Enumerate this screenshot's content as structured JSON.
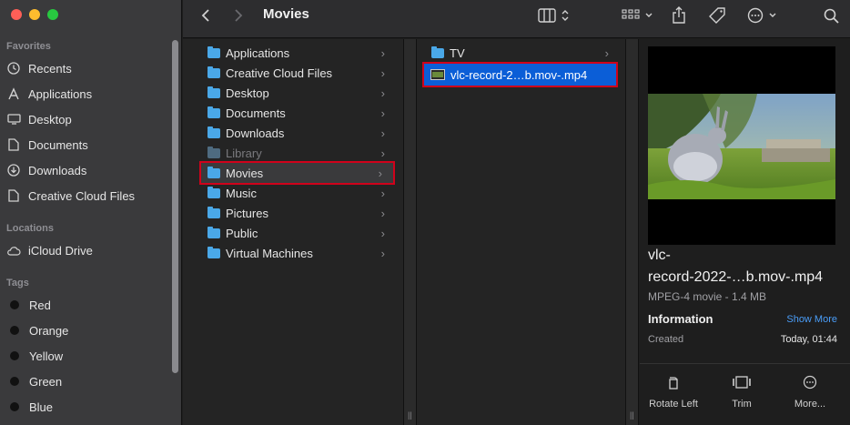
{
  "window": {
    "title": "Movies",
    "traffic_colors": [
      "#fe5f57",
      "#febc2e",
      "#28c840"
    ]
  },
  "sidebar": {
    "favorites_label": "Favorites",
    "favorites": [
      {
        "label": "Recents",
        "icon": "clock-icon"
      },
      {
        "label": "Applications",
        "icon": "applications-icon"
      },
      {
        "label": "Desktop",
        "icon": "desktop-icon"
      },
      {
        "label": "Documents",
        "icon": "document-icon"
      },
      {
        "label": "Downloads",
        "icon": "download-icon"
      },
      {
        "label": "Creative Cloud Files",
        "icon": "document-icon"
      }
    ],
    "locations_label": "Locations",
    "locations": [
      {
        "label": "iCloud Drive",
        "icon": "cloud-icon"
      }
    ],
    "tags_label": "Tags",
    "tags": [
      {
        "label": "Red"
      },
      {
        "label": "Orange"
      },
      {
        "label": "Yellow"
      },
      {
        "label": "Green"
      },
      {
        "label": "Blue"
      }
    ]
  },
  "column1": {
    "items": [
      {
        "label": "Applications"
      },
      {
        "label": "Creative Cloud Files"
      },
      {
        "label": "Desktop"
      },
      {
        "label": "Documents"
      },
      {
        "label": "Downloads"
      },
      {
        "label": "Library",
        "dimmed": true
      },
      {
        "label": "Movies",
        "selected": true
      },
      {
        "label": "Music"
      },
      {
        "label": "Pictures"
      },
      {
        "label": "Public"
      },
      {
        "label": "Virtual Machines"
      }
    ]
  },
  "column2": {
    "items": [
      {
        "label": "TV",
        "type": "folder"
      },
      {
        "label": "vlc-record-2…b.mov-.mp4",
        "type": "file",
        "selected": true
      }
    ]
  },
  "preview": {
    "file_name": "vlc-record-2022-…b.mov-.mp4",
    "file_name_lines": [
      "vlc-",
      "record-2022-…b.mov-.mp4"
    ],
    "kind": "MPEG-4 movie - 1.4 MB",
    "info_label": "Information",
    "show_more": "Show More",
    "created_label": "Created",
    "created_value": "Today, 01:44",
    "actions": [
      {
        "label": "Rotate Left",
        "icon": "rotate-left-icon"
      },
      {
        "label": "Trim",
        "icon": "trim-icon"
      },
      {
        "label": "More...",
        "icon": "more-icon"
      }
    ]
  },
  "colors": {
    "selection_blue": "#0b5ed7",
    "highlight_red": "#d0021b",
    "folder_blue": "#4aa8e8",
    "link_blue": "#4a9df8"
  }
}
